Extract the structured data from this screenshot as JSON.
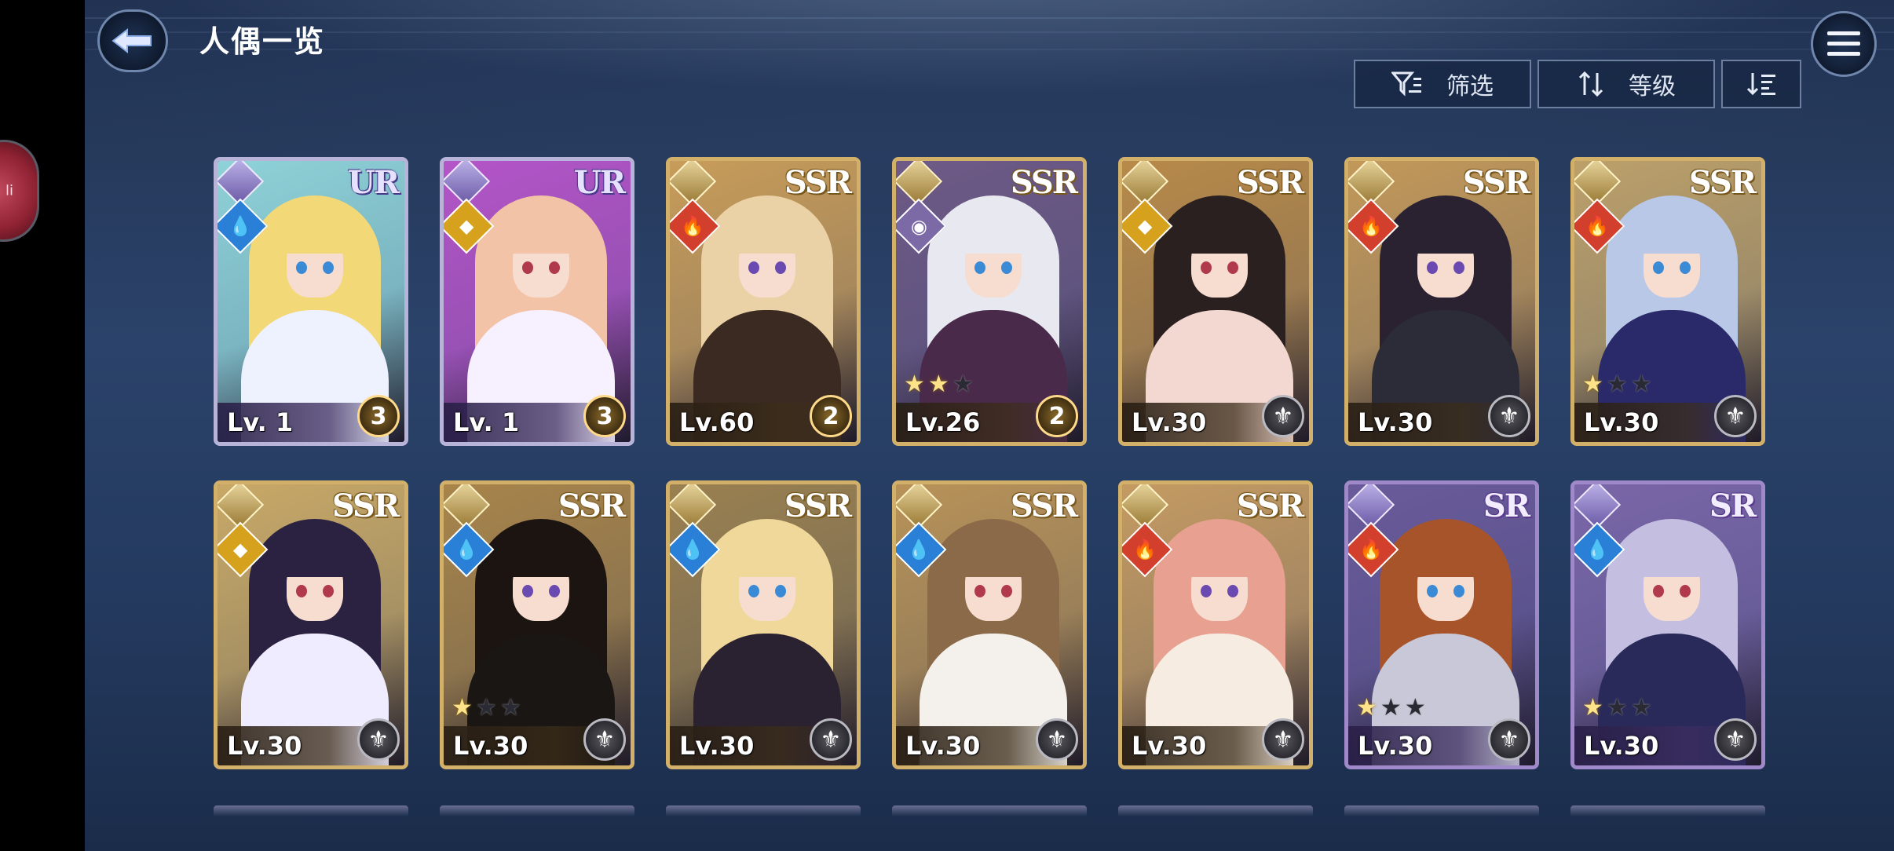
{
  "header": {
    "title": "人偶一览",
    "filter_label": "筛选",
    "sort_label": "等级"
  },
  "side_float": {
    "label": "li"
  },
  "colors": {
    "background": "#263a5c",
    "ur_frame": "#b8b3d8",
    "ssr_frame": "#d2b06a",
    "sr_frame": "#a089c8"
  },
  "cards": [
    {
      "rarity": "UR",
      "level": "Lv. 1",
      "element": "water",
      "class": "class-icon",
      "emblem": "3",
      "stars": 0,
      "hair": "#f3d878",
      "bg": "#8fd2d8",
      "outfit": "#eef2ff"
    },
    {
      "rarity": "UR",
      "level": "Lv. 1",
      "element": "light",
      "class": "class-icon",
      "emblem": "3",
      "stars": 0,
      "hair": "#f2c3a6",
      "bg": "#b455c8",
      "outfit": "#f6f0ff"
    },
    {
      "rarity": "SSR",
      "level": "Lv.60",
      "element": "fire",
      "class": "class-icon",
      "emblem": "2",
      "stars": 0,
      "hair": "#ead2a6",
      "bg": "#c89c5a",
      "outfit": "#3a2a22"
    },
    {
      "rarity": "SSR",
      "level": "Lv.26",
      "element": "eye",
      "class": "class-icon",
      "emblem": "2",
      "stars": 2,
      "hair": "#e8e8f0",
      "bg": "#6e5a86",
      "outfit": "#4a2a4a"
    },
    {
      "rarity": "SSR",
      "level": "Lv.30",
      "element": "light",
      "class": "class-icon",
      "emblem": "",
      "stars": 0,
      "hair": "#2a2020",
      "bg": "#b88a4a",
      "outfit": "#f2d8d0"
    },
    {
      "rarity": "SSR",
      "level": "Lv.30",
      "element": "fire",
      "class": "class-icon",
      "emblem": "",
      "stars": 0,
      "hair": "#2a2230",
      "bg": "#c2985a",
      "outfit": "#2c2c38"
    },
    {
      "rarity": "SSR",
      "level": "Lv.30",
      "element": "fire",
      "class": "class-icon",
      "emblem": "",
      "stars": 1,
      "hair": "#b8c8e6",
      "bg": "#bca06a",
      "outfit": "#2a2a6a"
    },
    {
      "rarity": "SSR",
      "level": "Lv.30",
      "element": "light",
      "class": "class-icon",
      "emblem": "",
      "stars": 0,
      "hair": "#2a2240",
      "bg": "#c8a866",
      "outfit": "#f0ecff"
    },
    {
      "rarity": "SSR",
      "level": "Lv.30",
      "element": "water",
      "class": "class-icon",
      "emblem": "",
      "stars": 1,
      "hair": "#1c1410",
      "bg": "#a8844a",
      "outfit": "#1a1614"
    },
    {
      "rarity": "SSR",
      "level": "Lv.30",
      "element": "water",
      "class": "class-icon",
      "emblem": "",
      "stars": 0,
      "hair": "#f0d89a",
      "bg": "#9a8050",
      "outfit": "#2a2230"
    },
    {
      "rarity": "SSR",
      "level": "Lv.30",
      "element": "water",
      "class": "class-icon",
      "emblem": "",
      "stars": 0,
      "hair": "#8a6a48",
      "bg": "#b89258",
      "outfit": "#f4f0ec"
    },
    {
      "rarity": "SSR",
      "level": "Lv.30",
      "element": "fire",
      "class": "class-icon",
      "emblem": "",
      "stars": 0,
      "hair": "#e8a090",
      "bg": "#c49a62",
      "outfit": "#f6ece2"
    },
    {
      "rarity": "SR",
      "level": "Lv.30",
      "element": "fire",
      "class": "class-icon",
      "emblem": "",
      "stars": 1,
      "hair": "#a8542a",
      "bg": "#6a5a9a",
      "outfit": "#c8c8d8"
    },
    {
      "rarity": "SR",
      "level": "Lv.30",
      "element": "water",
      "class": "class-icon",
      "emblem": "",
      "stars": 1,
      "hair": "#c4bfe0",
      "bg": "#7a66a8",
      "outfit": "#2a2a5a"
    }
  ]
}
